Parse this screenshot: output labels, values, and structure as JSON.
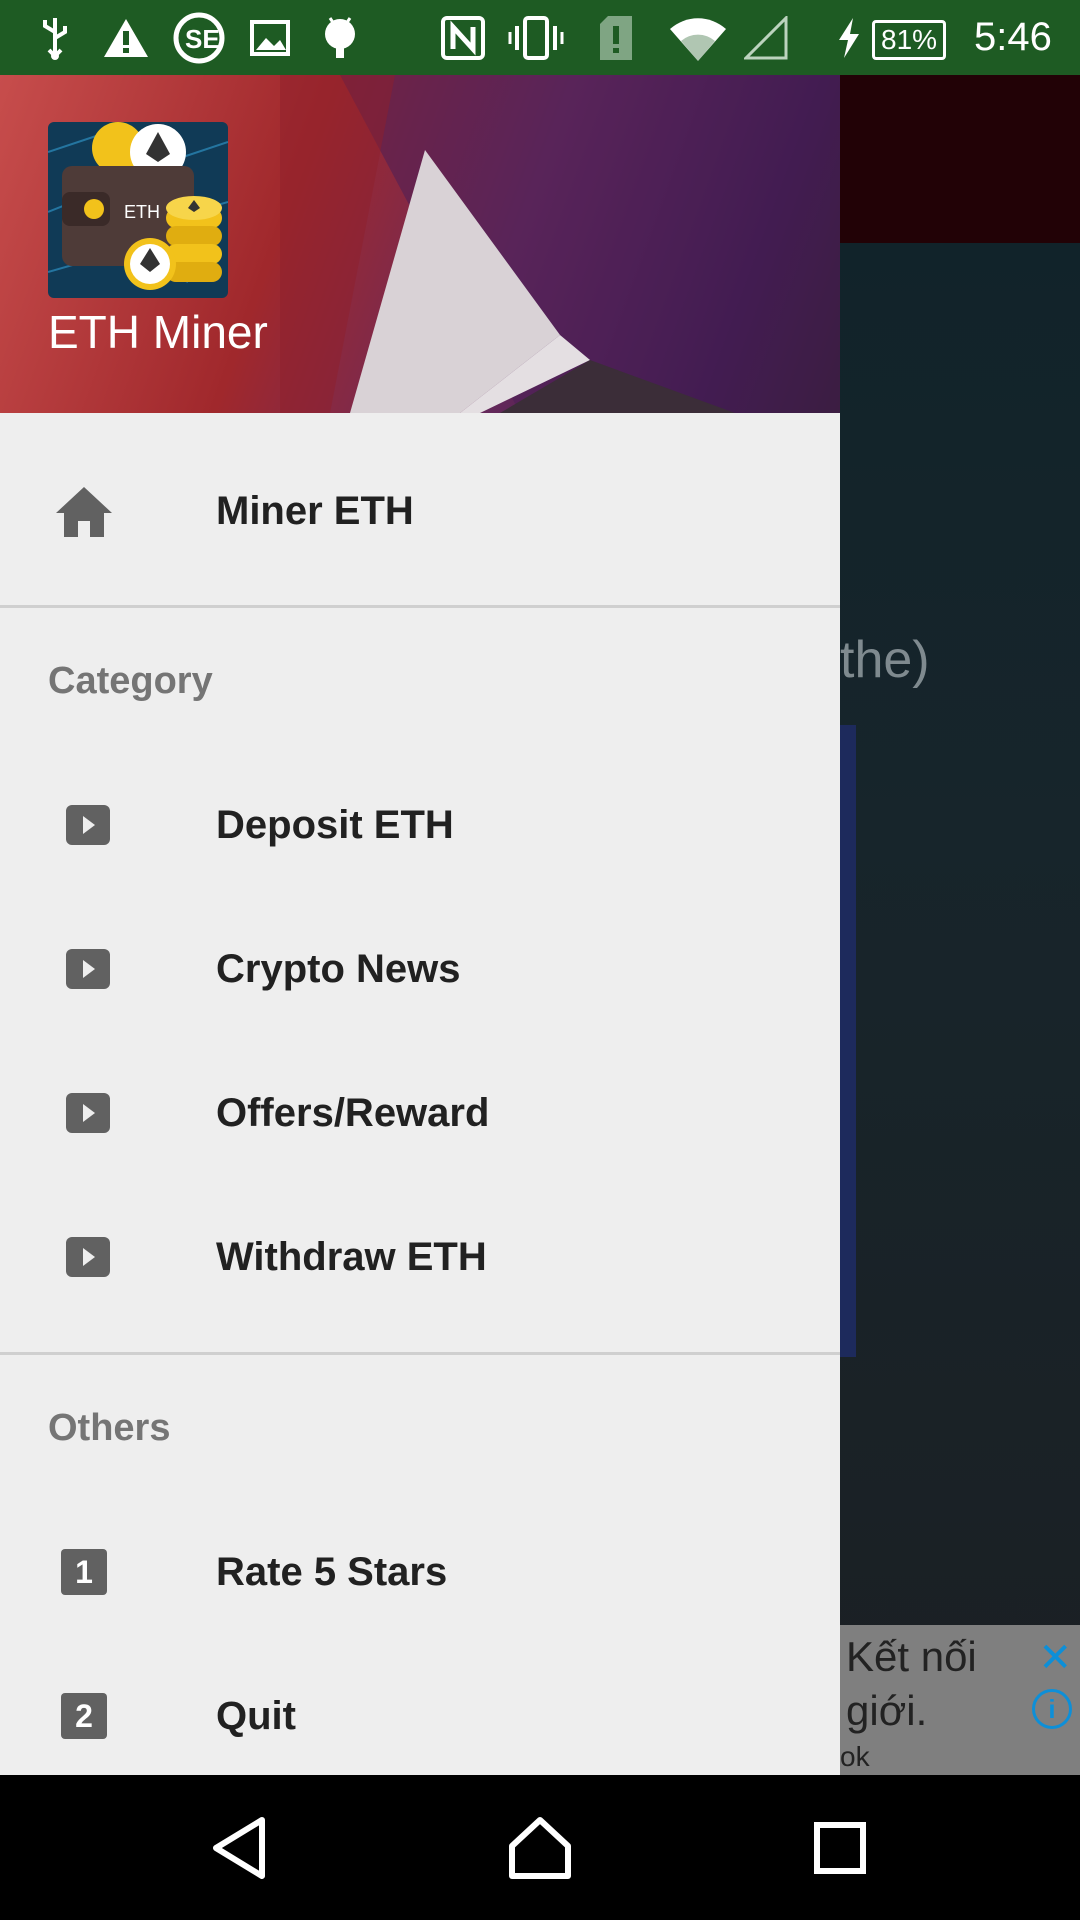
{
  "status_bar": {
    "icons": [
      "usb-icon",
      "warning-icon",
      "se-icon",
      "image-icon",
      "android-icon",
      "nfc-icon",
      "vibrate-icon",
      "sim-alert-icon",
      "wifi-icon",
      "signal-icon",
      "charging-icon"
    ],
    "battery": "81%",
    "time": "5:46",
    "color": "#1e5b23"
  },
  "drawer": {
    "app_name": "ETH Miner",
    "icon_label": "ETH",
    "home_item": {
      "label": "Miner ETH",
      "icon": "home-icon"
    },
    "category": {
      "title": "Category",
      "items": [
        {
          "label": "Deposit ETH",
          "icon": "play-icon"
        },
        {
          "label": "Crypto News",
          "icon": "play-icon"
        },
        {
          "label": "Offers/Reward",
          "icon": "play-icon"
        },
        {
          "label": "Withdraw ETH",
          "icon": "play-icon"
        }
      ]
    },
    "others": {
      "title": "Others",
      "items": [
        {
          "label": "Rate 5 Stars",
          "icon": "number-1-icon",
          "badge": "1"
        },
        {
          "label": "Quit",
          "icon": "number-2-icon",
          "badge": "2"
        }
      ]
    }
  },
  "background": {
    "partial_text": "the)",
    "ad": {
      "line1": "Kết nối",
      "line2": "giới.",
      "line3": "ok",
      "close": "✕",
      "info": "i"
    }
  },
  "nav_bar": {
    "buttons": [
      "back-icon",
      "home-icon",
      "recents-icon"
    ]
  }
}
